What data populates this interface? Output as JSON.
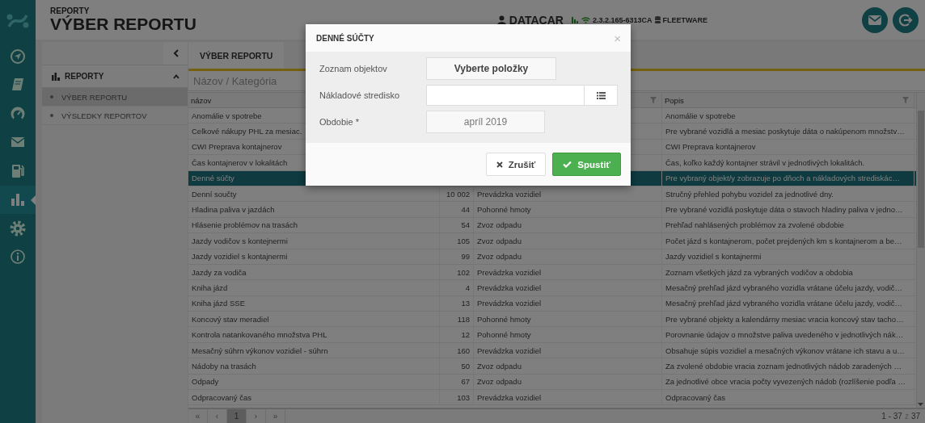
{
  "rail": {
    "items": [
      {
        "kind": "navigation",
        "selected": false
      },
      {
        "kind": "book",
        "selected": false
      },
      {
        "kind": "gauge",
        "selected": false
      },
      {
        "kind": "mail",
        "selected": false
      },
      {
        "kind": "fuel",
        "selected": false
      },
      {
        "kind": "chart",
        "selected": true
      },
      {
        "kind": "gear",
        "selected": false
      },
      {
        "kind": "info",
        "selected": false
      }
    ]
  },
  "header": {
    "section": "REPORTY",
    "title": "VÝBER REPORTU",
    "user": "DATACAR",
    "version": "2.3.2.165-6313CA",
    "database": "FLEETWARE"
  },
  "sidebar": {
    "group": "REPORTY",
    "expanded": true,
    "items": [
      {
        "label": "VÝBER REPORTU",
        "selected": true
      },
      {
        "label": "VÝSLEDKY REPORTOV",
        "selected": false
      }
    ]
  },
  "tabs": [
    {
      "label": "VÝBER REPORTU",
      "selected": true
    }
  ],
  "filter": {
    "placeholder": "Názov / Kategória"
  },
  "table": {
    "headers": {
      "name": "názov",
      "description": "Popis"
    },
    "rows": [
      {
        "name": "Anomálie v spotrebe",
        "description": "Anomálie v spotrebe",
        "selected": false
      },
      {
        "name": "Celkové nákupy PHL za mesiac.",
        "description": "Pre vybrané vozidlá a mesiac poskytuje dáta o nakúpenom množstv…",
        "selected": false
      },
      {
        "name": "CWI Preprava kontajnerov",
        "description": "CWI Preprava kontajnerov",
        "selected": false
      },
      {
        "name": "Čas kontajnerov v lokalitách",
        "description": "Čas, koľko každý kontajner strávil v jednotlivých lokalitách.",
        "selected": false
      },
      {
        "name": "Denné súčty",
        "description": "Pre vybraný objekt/y zobrazuje po dňoch a nákladových strediskác…",
        "selected": true
      },
      {
        "name": "Denní součty",
        "count": "10 002",
        "category": "Prevádzka vozidiel",
        "description": "Stručný přehled pohybu vozidel za jednotlivé dny.",
        "selected": false
      },
      {
        "name": "Hladina paliva v jazdách",
        "count": "44",
        "category": "Pohonné hmoty",
        "description": "Pre vybrané vozidlá poskytuje dáta o stavoch hladiny paliva v jedno…",
        "selected": false
      },
      {
        "name": "Hlásenie problémov na trasách",
        "count": "54",
        "category": "Zvoz odpadu",
        "description": "Prehľad nahlásených problémov za zvolené obdobie",
        "selected": false
      },
      {
        "name": "Jazdy vodičov s kontejnermi",
        "count": "105",
        "category": "Zvoz odpadu",
        "description": "Počet jázd s kontajnerom, počet prejdených km s kontajnerom a be…",
        "selected": false
      },
      {
        "name": "Jazdy vozidiel s kontajnermi",
        "count": "99",
        "category": "Zvoz odpadu",
        "description": "Jazdy vozidiel s kontajnermi",
        "selected": false
      },
      {
        "name": "Jazdy za vodiča",
        "count": "102",
        "category": "Prevádzka vozidiel",
        "description": "Zoznam všetkých jázd za vybraných vodičov a obdobia",
        "selected": false
      },
      {
        "name": "Kniha jázd",
        "count": "4",
        "category": "Prevádzka vozidiel",
        "description": "Mesačný prehľad jázd vybraného vozidla vrátane účelu jazdy, vodič…",
        "selected": false
      },
      {
        "name": "Kniha jázd SSE",
        "count": "13",
        "category": "Prevádzka vozidiel",
        "description": "Mesačný prehľad jázd vybraného vozidla vrátane účelu jazdy, vodič…",
        "selected": false
      },
      {
        "name": "Koncový stav meradiel",
        "count": "118",
        "category": "Pohonné hmoty",
        "description": "Pre vybrané objekty a kalendárny mesiac vracia koncový stav tacho…",
        "selected": false
      },
      {
        "name": "Kontrola natankovaného množstva PHL",
        "count": "12",
        "category": "Pohonné hmoty",
        "description": "Porovnanie údajov o množstve paliva uvedeného v jednotlivých nák…",
        "selected": false
      },
      {
        "name": "Mesačný súhrn výkonov vozidiel - súhrn",
        "count": "160",
        "category": "Prevádzka vozidiel",
        "description": "Obsahuje súpis vozidiel a mesačných výkonov vrátane ich stavu a u…",
        "selected": false
      },
      {
        "name": "Nádoby na trasách",
        "count": "50",
        "category": "Zvoz odpadu",
        "description": "Za zvolené obdobie vracia zoznam jednotlivých nádob zaradených …",
        "selected": false
      },
      {
        "name": "Odpady",
        "count": "67",
        "category": "Zvoz odpadu",
        "description": "Za jednotlivé obce vracia počty vyvezených nádob (rozlíšenie podľa …",
        "selected": false
      },
      {
        "name": "Odpracovaný čas",
        "count": "103",
        "category": "Prevádzka vozidiel",
        "description": "Odpracovaný čas",
        "selected": false
      }
    ]
  },
  "pager": {
    "first": "«",
    "prev": "‹",
    "pages": [
      {
        "label": "1",
        "selected": true
      }
    ],
    "next": "›",
    "last": "»",
    "range": "1 - 37",
    "of": "z",
    "total": "37"
  },
  "dialog": {
    "title": "DENNÉ SÚČTY",
    "close": "×",
    "fields": [
      {
        "kind": "picker",
        "label": "Zoznam objektov",
        "value": "Vyberte položky"
      },
      {
        "kind": "list",
        "label": "Nákladové stredisko"
      },
      {
        "kind": "date",
        "label": "Obdobie *",
        "value": "apríl 2019"
      }
    ],
    "buttons": [
      {
        "kind": "cancel",
        "label": "Zrušiť"
      },
      {
        "kind": "run",
        "label": "Spustiť"
      }
    ]
  }
}
